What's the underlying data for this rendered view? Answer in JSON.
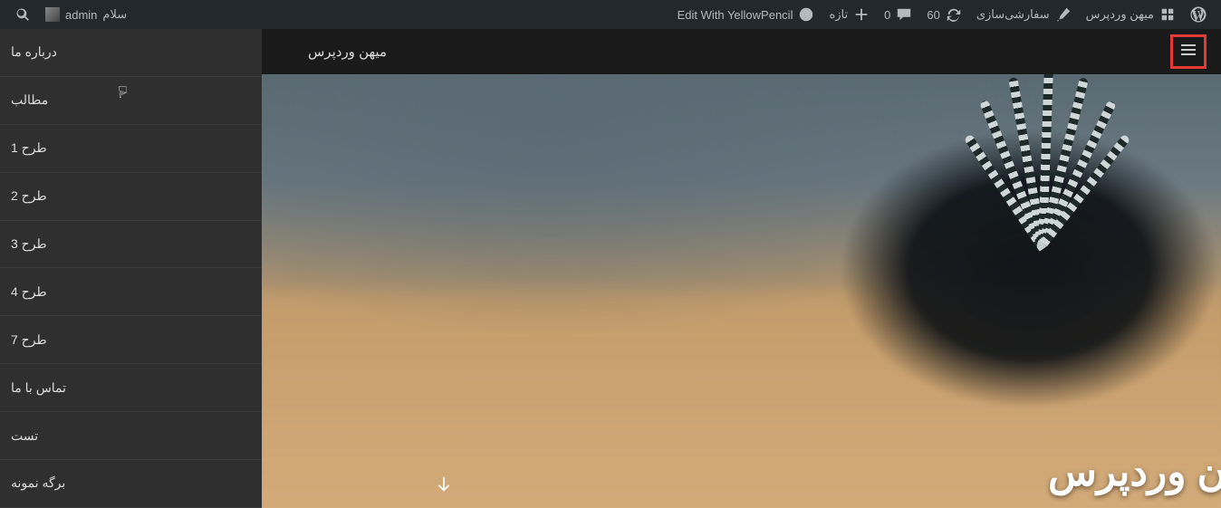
{
  "adminbar": {
    "site_name": "میهن وردپرس",
    "customize": "سفارشی‌سازی",
    "updates_count": "60",
    "comments_count": "0",
    "new_label": "تازه",
    "yellow_pencil": "Edit With YellowPencil",
    "howdy_prefix": "سلام",
    "user_name": "admin"
  },
  "site_header": {
    "title": "میهن وردپرس"
  },
  "sidebar": {
    "items": [
      {
        "label": "درباره ما"
      },
      {
        "label": "مطالب"
      },
      {
        "label": "طرح 1"
      },
      {
        "label": "طرح 2"
      },
      {
        "label": "طرح 3"
      },
      {
        "label": "طرح 4"
      },
      {
        "label": "طرح 7"
      },
      {
        "label": "تماس با ما"
      },
      {
        "label": "تست"
      },
      {
        "label": "برگه نمونه"
      }
    ]
  },
  "hero": {
    "title_fragment": "ن وردپرس"
  }
}
